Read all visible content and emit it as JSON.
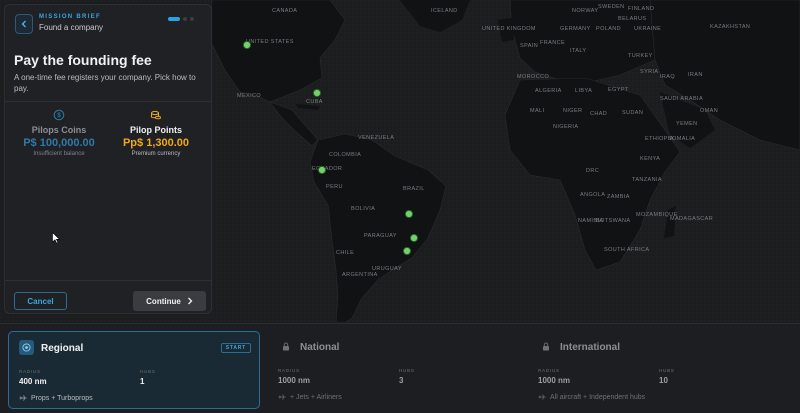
{
  "brief": {
    "eyebrow": "MISSION BRIEF",
    "subtitle": "Found a company",
    "back_icon": "chevron-left-icon"
  },
  "fee": {
    "title": "Pay the founding fee",
    "description": "A one-time fee registers your company. Pick how to pay.",
    "options": [
      {
        "name": "Pilops Coins",
        "value": "P$ 100,000.00",
        "note": "Insufficient balance",
        "icon": "coin-icon",
        "color": "#2e7aa6"
      },
      {
        "name": "Pilop Points",
        "value": "Pp$ 1,300.00",
        "note": "Premium currency",
        "icon": "coins-stack-icon",
        "color": "#f0a81c"
      }
    ],
    "cancel_label": "Cancel",
    "continue_label": "Continue"
  },
  "map": {
    "labels": [
      "UNITED STATES",
      "CANADA",
      "MEXICO",
      "CUBA",
      "VENEZUELA",
      "COLOMBIA",
      "ECUADOR",
      "PERU",
      "BRAZIL",
      "BOLIVIA",
      "PARAGUAY",
      "CHILE",
      "ARGENTINA",
      "URUGUAY",
      "ICELAND",
      "NORWAY",
      "SWEDEN",
      "FINLAND",
      "UNITED KINGDOM",
      "GERMANY",
      "POLAND",
      "FRANCE",
      "SPAIN",
      "ITALY",
      "UKRAINE",
      "BELARUS",
      "TURKEY",
      "IRAN",
      "SAUDI ARABIA",
      "EGYPT",
      "LIBYA",
      "ALGERIA",
      "MOROCCO",
      "MALI",
      "NIGER",
      "CHAD",
      "SUDAN",
      "NIGERIA",
      "ETHIOPIA",
      "SOMALIA",
      "KENYA",
      "TANZANIA",
      "DRC",
      "ANGOLA",
      "ZAMBIA",
      "NAMIBIA",
      "BOTSWANA",
      "SOUTH AFRICA",
      "MOZAMBIQUE",
      "MADAGASCAR",
      "KAZAKHSTAN",
      "SYRIA",
      "IRAQ",
      "YEMEN",
      "OMAN"
    ],
    "hub_count": 6
  },
  "tiers": [
    {
      "name": "Regional",
      "badge": "START",
      "radius_label": "RADIUS",
      "radius": "400 nm",
      "hubs_label": "HUBS",
      "hubs": "1",
      "footer": "Props + Turboprops",
      "icon": "target-icon"
    },
    {
      "name": "National",
      "radius_label": "RADIUS",
      "radius": "1000 nm",
      "hubs_label": "HUBS",
      "hubs": "3",
      "footer": "+ Jets + Airliners",
      "icon": "lock-icon"
    },
    {
      "name": "International",
      "radius_label": "RADIUS",
      "radius": "1000 nm",
      "hubs_label": "HUBS",
      "hubs": "10",
      "footer": "All aircraft + Independent hubs",
      "icon": "lock-icon"
    }
  ],
  "colors": {
    "accent": "#2aa3e0",
    "gold": "#f0a81c",
    "hub": "#6fd36a"
  }
}
